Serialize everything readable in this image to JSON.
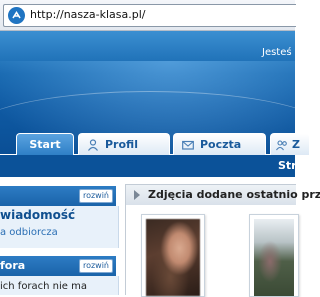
{
  "browser": {
    "url": "http://nasza-klasa.pl/",
    "favicon": "nasza-klasa-logo-icon"
  },
  "header": {
    "user_text": "Jesteś"
  },
  "tabs": [
    {
      "label": "Start",
      "icon": ""
    },
    {
      "label": "Profil",
      "icon": "person-icon"
    },
    {
      "label": "Poczta",
      "icon": "envelope-icon"
    },
    {
      "label": "Z",
      "icon": "people-icon"
    }
  ],
  "navbar": {
    "right_text": "Stro"
  },
  "left_boxes": [
    {
      "title": "",
      "toggle": "rozwiń",
      "bold_line": "wiadomość",
      "link_line": "a odbiorcza"
    },
    {
      "title": "fora",
      "toggle": "rozwiń",
      "text_line": "ich forach nie ma"
    }
  ],
  "main": {
    "title": "Zdjęcia dodane ostatnio przez"
  },
  "colors": {
    "header_blue": "#1566ae",
    "tab_active": "#3b8ad0",
    "link_blue": "#2a6eb4"
  }
}
